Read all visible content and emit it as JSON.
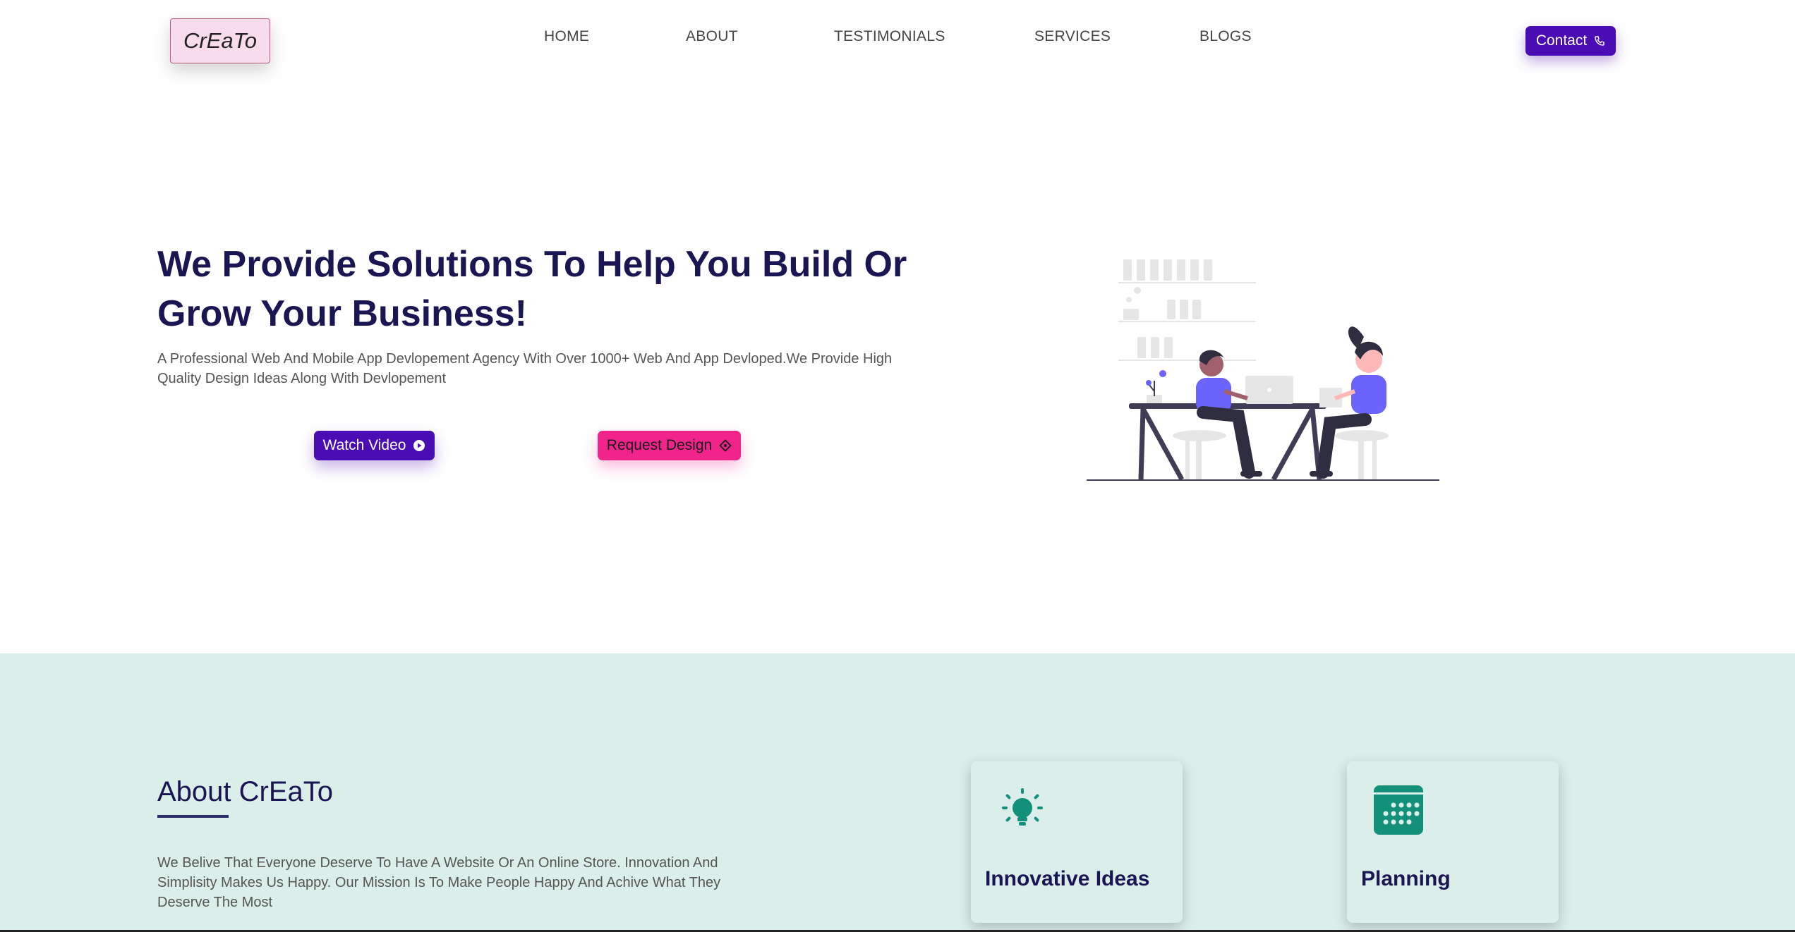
{
  "brand": {
    "logo_text": "CrEaTo"
  },
  "nav": {
    "links": [
      "HOME",
      "ABOUT",
      "TESTIMONIALS",
      "SERVICES",
      "BLOGS"
    ],
    "contact_label": "Contact"
  },
  "hero": {
    "title": "We Provide Solutions To Help You Build Or Grow Your Business!",
    "subtitle": "A Professional Web And Mobile App Devlopement Agency With Over 1000+ Web And App Devloped.We Provide High Quality Design Ideas Along With Devlopement",
    "watch_video_label": "Watch Video",
    "request_design_label": "Request Design",
    "illustration_icon": "team-at-desk-illustration"
  },
  "about": {
    "title": "About CrEaTo",
    "text": "We Belive That Everyone Deserve To Have A Website Or An Online Store. Innovation And Simplisity Makes Us Happy. Our Mission Is To Make People Happy And Achive What They Deserve The Most",
    "cards": [
      {
        "title": "Innovative Ideas",
        "icon": "lightbulb-icon"
      },
      {
        "title": "Planning",
        "icon": "calendar-icon"
      }
    ]
  },
  "colors": {
    "primary": "#4a0db3",
    "accent": "#f0248a",
    "heading": "#1a1654",
    "about_bg": "#dbeeea",
    "icon_teal": "#12907a"
  }
}
